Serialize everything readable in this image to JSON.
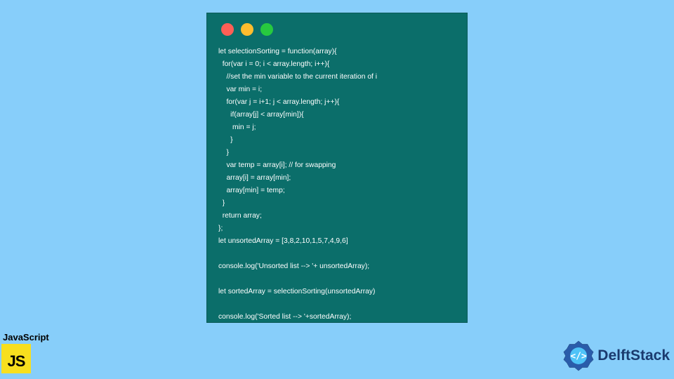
{
  "window": {
    "dots": [
      "red",
      "yellow",
      "green"
    ]
  },
  "code_lines": [
    "let selectionSorting = function(array){",
    "  for(var i = 0; i < array.length; i++){",
    "    //set the min variable to the current iteration of i",
    "    var min = i;",
    "    for(var j = i+1; j < array.length; j++){",
    "      if(array[j] < array[min]){",
    "       min = j;",
    "      }",
    "    }",
    "    var temp = array[i]; // for swapping",
    "    array[i] = array[min];",
    "    array[min] = temp;",
    "  }",
    "  return array;",
    "};",
    "let unsortedArray = [3,8,2,10,1,5,7,4,9,6]",
    "",
    "console.log('Unsorted list --> '+ unsortedArray);",
    "",
    "let sortedArray = selectionSorting(unsortedArray)",
    "",
    "console.log('Sorted list --> '+sortedArray);"
  ],
  "badges": {
    "js_label": "JavaScript",
    "js_logo_text": "JS",
    "delft_text": "DelftStack"
  },
  "colors": {
    "background": "#87cefa",
    "window_bg": "#0b6e6a",
    "js_yellow": "#f7df1e",
    "delft_blue": "#1a3a6e"
  }
}
